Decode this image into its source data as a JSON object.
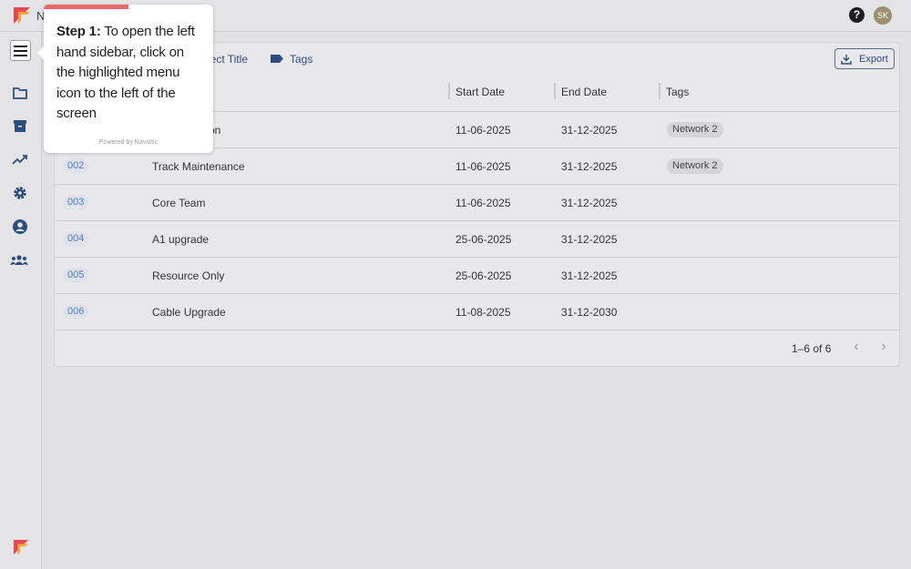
{
  "app": {
    "initial": "N",
    "avatar_initials": "SK",
    "brand_colors": [
      "#e5484d",
      "#f2a33a"
    ]
  },
  "header": {
    "help_icon": "?"
  },
  "toolbar": {
    "project_title_label": "ject Title",
    "tags_label": "Tags",
    "export_label": "Export"
  },
  "table": {
    "headers": {
      "start_date": "Start Date",
      "end_date": "End Date",
      "tags": "Tags"
    },
    "rows": [
      {
        "id": "",
        "name": "tion",
        "start": "11-06-2025",
        "end": "31-12-2025",
        "tag": "Network 2"
      },
      {
        "id": "002",
        "name": "Track Maintenance",
        "start": "11-06-2025",
        "end": "31-12-2025",
        "tag": "Network 2"
      },
      {
        "id": "003",
        "name": "Core Team",
        "start": "11-06-2025",
        "end": "31-12-2025",
        "tag": ""
      },
      {
        "id": "004",
        "name": "A1 upgrade",
        "start": "25-06-2025",
        "end": "31-12-2025",
        "tag": ""
      },
      {
        "id": "005",
        "name": "Resource Only",
        "start": "25-06-2025",
        "end": "31-12-2025",
        "tag": ""
      },
      {
        "id": "006",
        "name": "Cable Upgrade",
        "start": "11-08-2025",
        "end": "31-12-2030",
        "tag": ""
      }
    ],
    "pagination": "1–6 of 6"
  },
  "tooltip": {
    "step_label": "Step 1:",
    "text": " To open the left hand sidebar, click on the highlighted menu icon to the left of the screen",
    "powered_by": "Powered by Navattic",
    "progress_fraction": 0.5,
    "progress_color": "#e8686e"
  }
}
